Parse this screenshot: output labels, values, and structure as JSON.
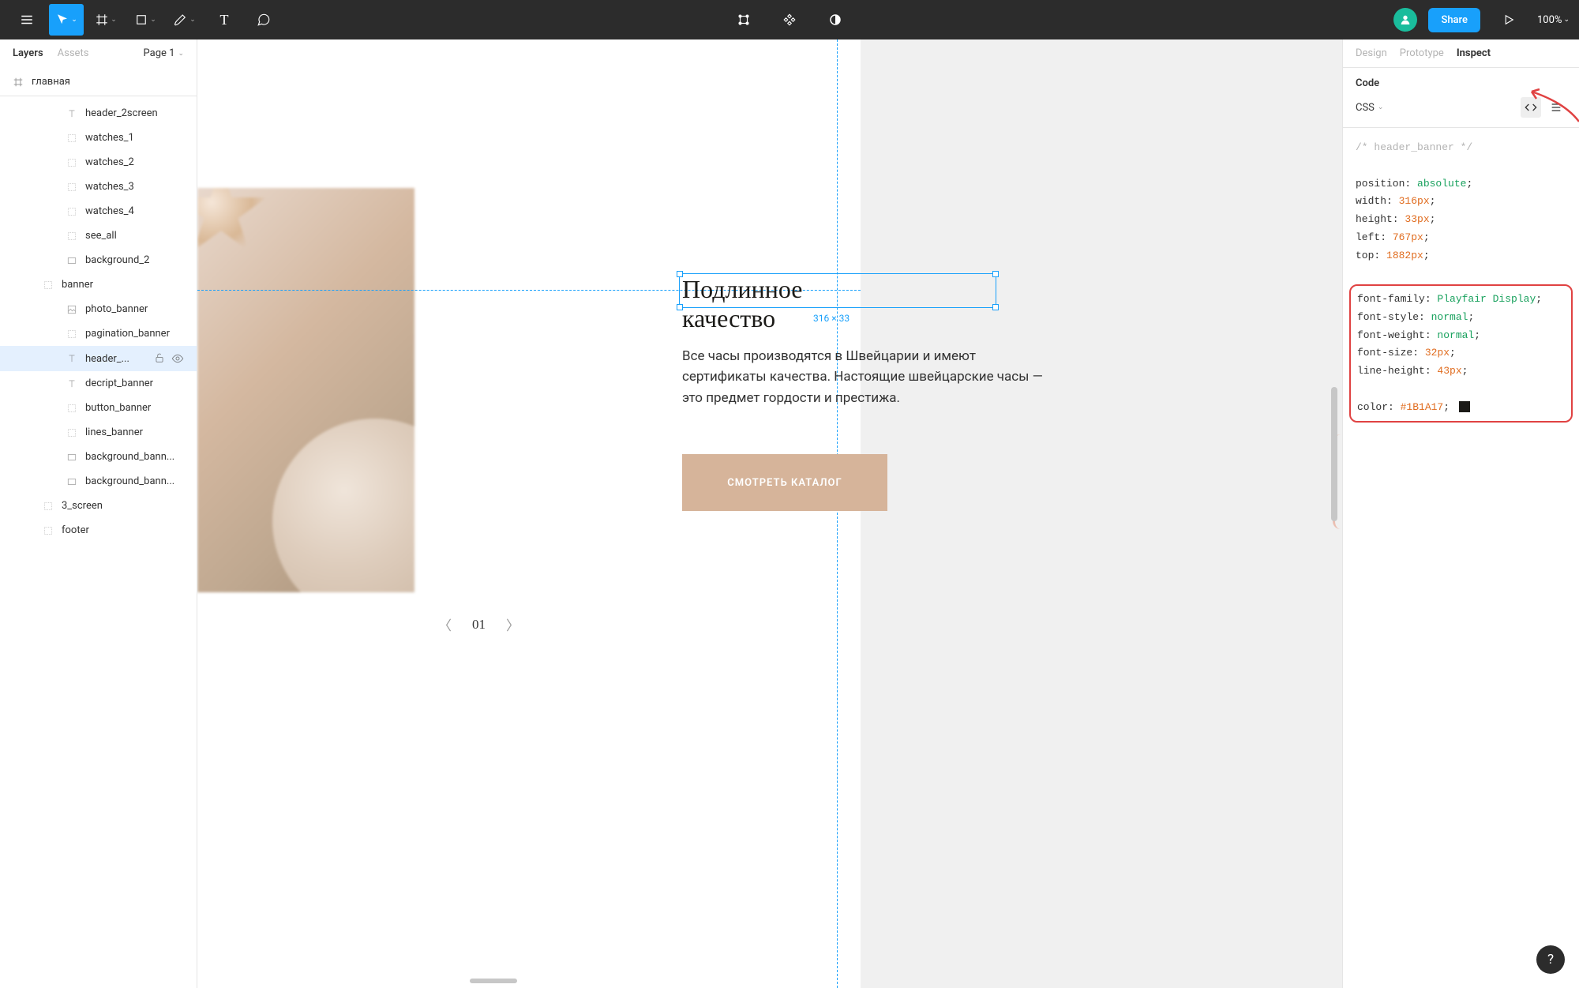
{
  "toolbar": {
    "share_label": "Share",
    "zoom": "100%"
  },
  "left_panel": {
    "tabs": [
      "Layers",
      "Assets"
    ],
    "page": "Page 1",
    "frame": "главная",
    "layers": [
      {
        "name": "header_2screen",
        "icon": "text",
        "indent": 2
      },
      {
        "name": "watches_1",
        "icon": "group",
        "indent": 2
      },
      {
        "name": "watches_2",
        "icon": "group",
        "indent": 2
      },
      {
        "name": "watches_3",
        "icon": "group",
        "indent": 2
      },
      {
        "name": "watches_4",
        "icon": "group",
        "indent": 2
      },
      {
        "name": "see_all",
        "icon": "group",
        "indent": 2
      },
      {
        "name": "background_2",
        "icon": "rect",
        "indent": 2
      },
      {
        "name": "banner",
        "icon": "group",
        "indent": 1
      },
      {
        "name": "photo_banner",
        "icon": "image",
        "indent": 2
      },
      {
        "name": "pagination_banner",
        "icon": "group",
        "indent": 2
      },
      {
        "name": "header_...",
        "icon": "text",
        "indent": 2,
        "selected": true,
        "actions": true
      },
      {
        "name": "decript_banner",
        "icon": "text",
        "indent": 2
      },
      {
        "name": "button_banner",
        "icon": "group",
        "indent": 2
      },
      {
        "name": "lines_banner",
        "icon": "group",
        "indent": 2
      },
      {
        "name": "background_bann...",
        "icon": "rect",
        "indent": 2
      },
      {
        "name": "background_bann...",
        "icon": "rect",
        "indent": 2
      },
      {
        "name": "3_screen",
        "icon": "group",
        "indent": 1
      },
      {
        "name": "footer",
        "icon": "group",
        "indent": 1
      }
    ]
  },
  "canvas": {
    "banner_title": "Подлинное качество",
    "banner_desc": "Все часы производятся в Швейцарии и имеют сертификаты качества. Настоящие швейцарские часы — это предмет гордости и престижа.",
    "button_label": "СМОТРЕТЬ КАТАЛОГ",
    "pager_current": "01",
    "selection_dims": "316 × 33"
  },
  "right_panel": {
    "tabs": [
      "Design",
      "Prototype",
      "Inspect"
    ],
    "code_section": "Code",
    "lang": "CSS",
    "code": {
      "comment": "/* header_banner */",
      "lines_top": [
        {
          "prop": "position",
          "val": "absolute",
          "cls": "tok-v"
        },
        {
          "prop": "width",
          "val": "316px",
          "cls": "tok-n"
        },
        {
          "prop": "height",
          "val": "33px",
          "cls": "tok-n"
        },
        {
          "prop": "left",
          "val": "767px",
          "cls": "tok-n"
        },
        {
          "prop": "top",
          "val": "1882px",
          "cls": "tok-n"
        }
      ],
      "lines_hl": [
        {
          "prop": "font-family",
          "val": "Playfair Display",
          "cls": "tok-v"
        },
        {
          "prop": "font-style",
          "val": "normal",
          "cls": "tok-v"
        },
        {
          "prop": "font-weight",
          "val": "normal",
          "cls": "tok-v"
        },
        {
          "prop": "font-size",
          "val": "32px",
          "cls": "tok-n"
        },
        {
          "prop": "line-height",
          "val": "43px",
          "cls": "tok-n"
        }
      ],
      "color_prop": "color",
      "color_val": "#1B1A17"
    }
  },
  "help": "?"
}
